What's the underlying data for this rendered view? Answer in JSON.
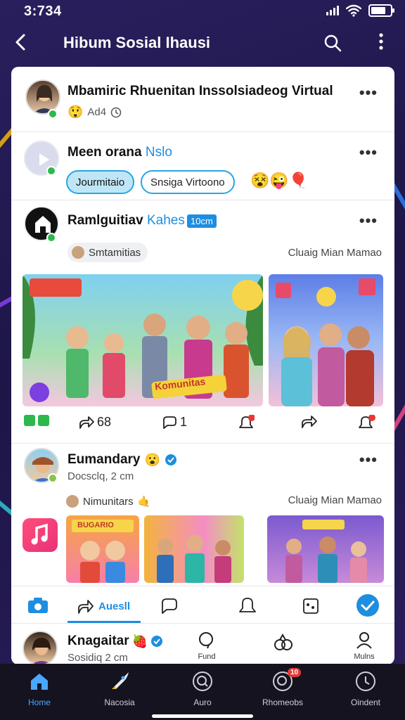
{
  "status_bar": {
    "time": "3:734"
  },
  "header": {
    "title": "Hibum Sosial Ihausi"
  },
  "posts": [
    {
      "name": "Mbamiric Rhuenitan Inssolsiadeog Virtual",
      "meta": "Ad4"
    },
    {
      "name": "Meen orana",
      "name_accent": "Nslo",
      "pill_1": "Jourmitaio",
      "pill_2": "Snsiga Virtoono"
    },
    {
      "name": "Ramlguitiav",
      "name_accent": "Kahes",
      "tag": "10cm",
      "chip": "Smtamitias",
      "right_text": "Cluaig Mian Mamao",
      "banner_text": "Komunitas",
      "actions": {
        "share_count": "68",
        "comment_count": "1"
      }
    },
    {
      "name": "Eumandary",
      "sub": "Docsclq, 2 cm",
      "chip": "Nimunitars",
      "right_text": "Cluaig Mian Mamao",
      "comic_label": "BUGARIO"
    },
    {
      "name": "Knagaitar",
      "sub": "Sosidiq 2 cm"
    }
  ],
  "composer_actions": {
    "share_label": "Auesll"
  },
  "inline_nav": {
    "find": "Fund",
    "friends": "Mulns"
  },
  "tabbar": {
    "items": [
      {
        "label": "Home"
      },
      {
        "label": "Nacosia"
      },
      {
        "label": "Auro"
      },
      {
        "label": "Rhomeobs",
        "badge": "10"
      },
      {
        "label": "Oindent"
      }
    ]
  },
  "colors": {
    "accent": "#1d8ee0",
    "online": "#2db84d",
    "tab_active": "#49a7ff",
    "background": "#211a4f"
  }
}
